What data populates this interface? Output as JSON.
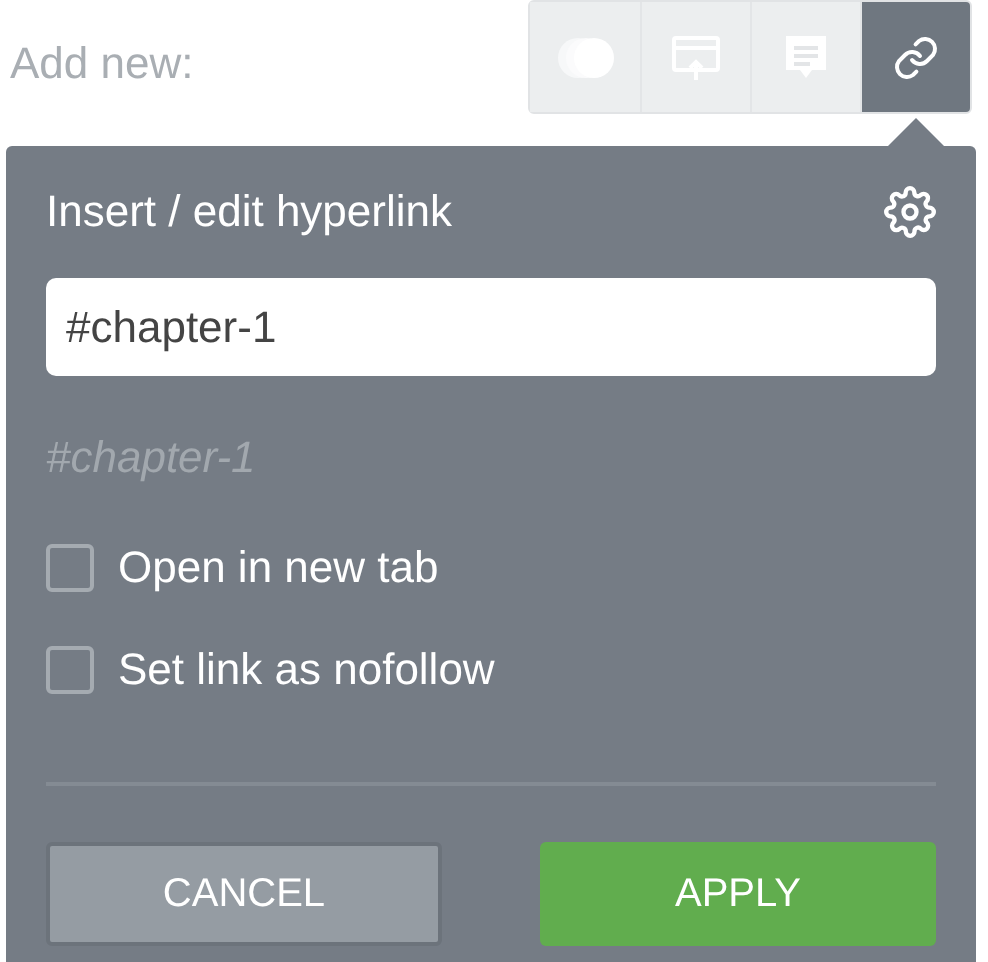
{
  "add_new_label": "Add new:",
  "toolbar": [
    {
      "kind": "circles",
      "selected": false
    },
    {
      "kind": "popup",
      "selected": false
    },
    {
      "kind": "comment",
      "selected": false
    },
    {
      "kind": "link",
      "selected": true
    }
  ],
  "dialog": {
    "title": "Insert / edit hyperlink",
    "url_value": "#chapter-1",
    "preview": "#chapter-1",
    "options": [
      {
        "label": "Open in new tab",
        "checked": false
      },
      {
        "label": "Set link as nofollow",
        "checked": false
      }
    ],
    "buttons": [
      {
        "label": "CANCEL",
        "kind": "cancel"
      },
      {
        "label": "APPLY",
        "kind": "apply"
      }
    ]
  }
}
